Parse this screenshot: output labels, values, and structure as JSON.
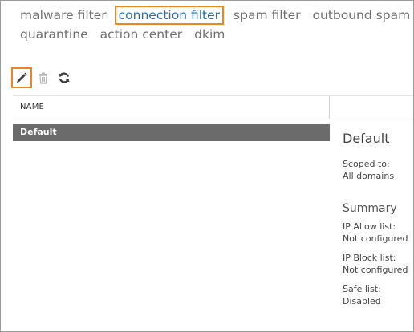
{
  "nav": {
    "row1": [
      "malware filter",
      "connection filter",
      "spam filter",
      "outbound spam"
    ],
    "row2": [
      "quarantine",
      "action center",
      "dkim"
    ],
    "active": "connection filter"
  },
  "toolbar": {
    "edit_icon": "pencil-icon",
    "delete_icon": "trash-icon",
    "refresh_icon": "refresh-icon"
  },
  "grid": {
    "column_name": "NAME",
    "rows": [
      "Default"
    ]
  },
  "details": {
    "title": "Default",
    "scoped_label": "Scoped to:",
    "scoped_value": "All domains",
    "summary_heading": "Summary",
    "ip_allow_label": "IP Allow list:",
    "ip_allow_value": "Not configured",
    "ip_block_label": "IP Block list:",
    "ip_block_value": "Not configured",
    "safe_list_label": "Safe list:",
    "safe_list_value": "Disabled"
  },
  "colors": {
    "accent_active": "#1e6fbf",
    "highlight_border": "#f0851f",
    "selected_row": "#6b6b6b"
  }
}
